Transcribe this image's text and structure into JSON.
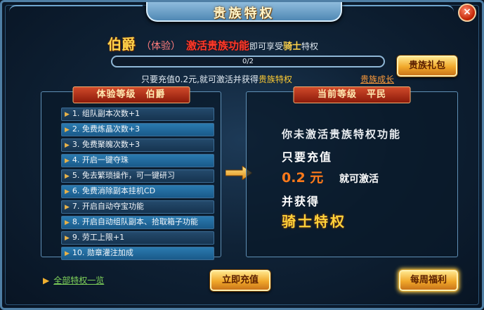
{
  "window": {
    "title": "贵族特权",
    "close_label": "×"
  },
  "header": {
    "rank": "伯爵",
    "trial": "（体验）",
    "activate": "激活贵族功能",
    "enjoy": "即可享受",
    "knight": "骑士",
    "privilege": "特权"
  },
  "progress": {
    "label": "0/2",
    "value": 0,
    "max": 2
  },
  "tip": {
    "prefix": "只要充值0.2元,就可激活并获得",
    "highlight": "贵族特权"
  },
  "links": {
    "growth": "贵族成长",
    "all_privileges": "全部特权一览"
  },
  "buttons": {
    "gift": "贵族礼包",
    "recharge": "立即充值",
    "weekly": "每周福利"
  },
  "left_panel": {
    "header": "体验等级　伯爵",
    "items": [
      "1. 组队副本次数+1",
      "2. 免费炼晶次数+3",
      "3. 免费聚魄次数+3",
      "4. 开启一键夺珠",
      "5. 免去繁琐操作，可一键研习",
      "6. 免费消除副本挂机CD",
      "7. 开启自动夺宝功能",
      "8. 开启自动组队副本、拾取箱子功能",
      "9. 劳工上限+1",
      "10. 勋章灌注加成"
    ]
  },
  "right_panel": {
    "header": "当前等级　平民",
    "line1": "你未激活贵族特权功能",
    "line2": "只要充值",
    "amount": "0.2 元",
    "activate_suffix": "就可激活",
    "line4": "并获得",
    "reward": "骑士特权"
  },
  "colors": {
    "accent_gold": "#ffd24a",
    "alert_red": "#ff3a2a",
    "panel_header": "#8c1a0a"
  }
}
